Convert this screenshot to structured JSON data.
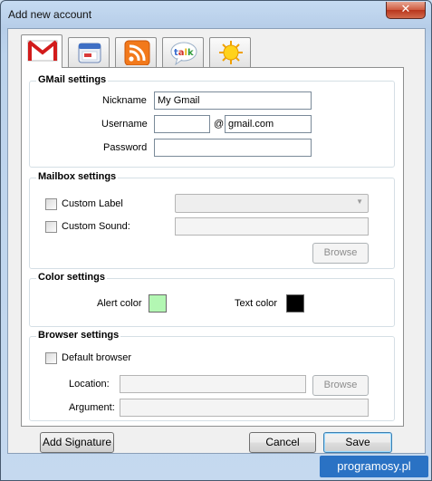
{
  "window": {
    "title": "Add new account",
    "close_glyph": "✕"
  },
  "tabs": [
    {
      "name": "gmail-icon"
    },
    {
      "name": "calendar-icon"
    },
    {
      "name": "rss-icon"
    },
    {
      "name": "google-talk-icon",
      "text": "talk"
    },
    {
      "name": "weather-sun-icon"
    }
  ],
  "gmail_settings": {
    "title": "GMail settings",
    "nickname_label": "Nickname",
    "nickname_value": "My Gmail",
    "username_label": "Username",
    "username_value": "",
    "at_sign": "@",
    "domain_value": "gmail.com",
    "password_label": "Password",
    "password_value": ""
  },
  "mailbox_settings": {
    "title": "Mailbox settings",
    "custom_label": "Custom Label",
    "custom_sound": "Custom Sound:",
    "browse_label": "Browse"
  },
  "color_settings": {
    "title": "Color settings",
    "alert_color_label": "Alert color",
    "alert_color": "#b3f7b3",
    "text_color_label": "Text color",
    "text_color": "#000000"
  },
  "browser_settings": {
    "title": "Browser settings",
    "default_browser": "Default browser",
    "location_label": "Location:",
    "argument_label": "Argument:",
    "browse_label": "Browse"
  },
  "footer": {
    "add_signature": "Add Signature",
    "cancel": "Cancel",
    "save": "Save"
  },
  "watermark": "programosy.pl"
}
